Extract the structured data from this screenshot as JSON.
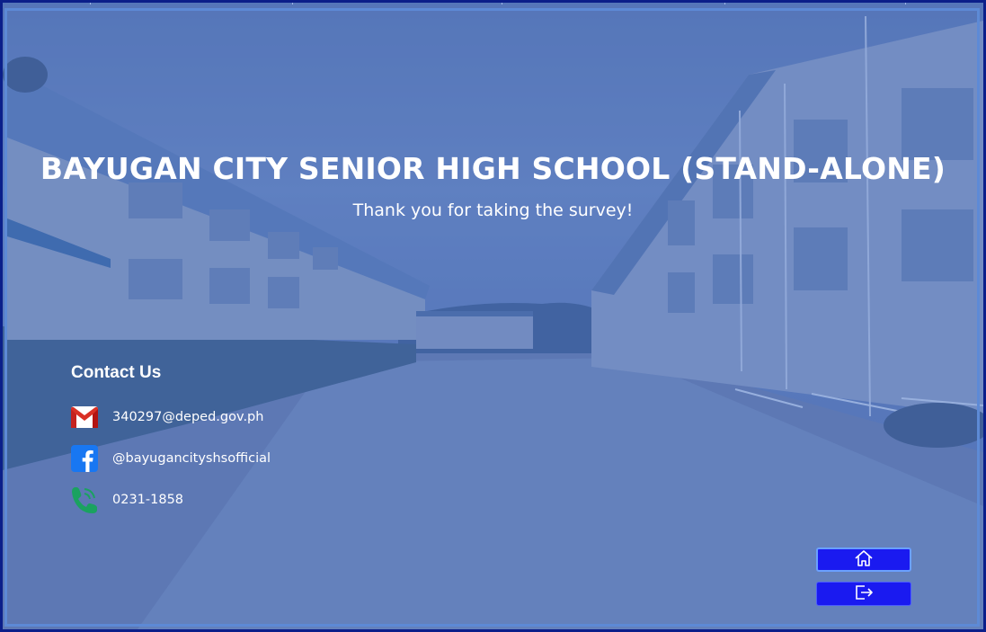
{
  "header": {
    "title": "BAYUGAN CITY SENIOR HIGH SCHOOL (STAND-ALONE)",
    "subtitle": "Thank you for taking the survey!"
  },
  "contact": {
    "heading": "Contact Us",
    "items": [
      {
        "icon": "gmail-icon",
        "text": "340297@deped.gov.ph"
      },
      {
        "icon": "facebook-icon",
        "text": "@bayugancityshsofficial"
      },
      {
        "icon": "phone-icon",
        "text": "0231-1858"
      }
    ]
  },
  "nav": {
    "home_icon": "home-icon",
    "exit_icon": "exit-icon"
  },
  "colors": {
    "frame": "#0b1f8a",
    "button": "#1a1af0",
    "button_border": "#6aa0ff",
    "gmail_red": "#d93025",
    "facebook_blue": "#1877f2",
    "phone_green": "#1aa260"
  }
}
